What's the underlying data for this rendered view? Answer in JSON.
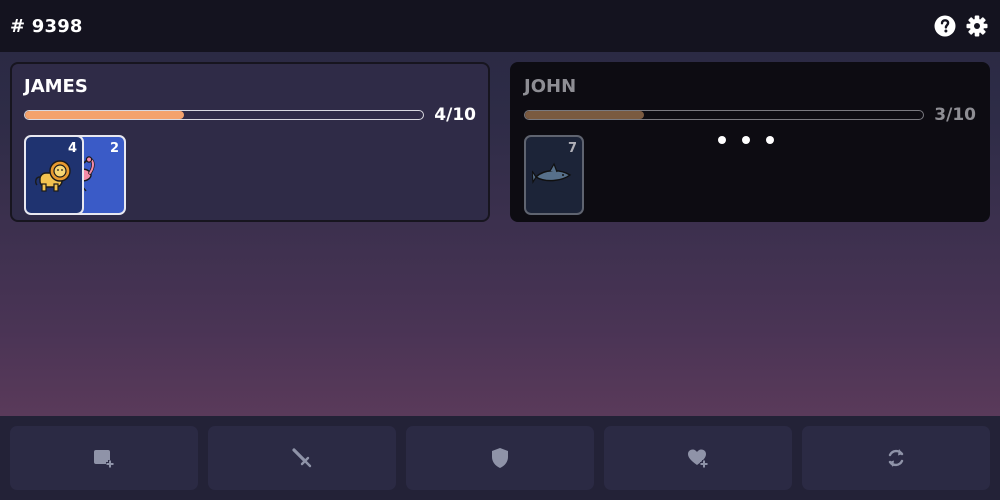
{
  "header": {
    "room_id": "# 9398",
    "icons": [
      "help-icon",
      "gear-icon"
    ]
  },
  "player": {
    "name": "JAMES",
    "progress": 0.4,
    "score": "4/10",
    "accent": "#f4a26c",
    "cards": [
      {
        "value": "4",
        "animal": "lion",
        "color": "#1f3370"
      },
      {
        "value": "2",
        "animal": "flamingo",
        "color": "#3a5bc7"
      }
    ]
  },
  "opponent": {
    "name": "JOHN",
    "progress": 0.3,
    "score": "3/10",
    "status": "thinking",
    "cards": [
      {
        "value": "7",
        "animal": "shark",
        "color": "#1c2438"
      }
    ]
  },
  "actions": [
    {
      "name": "add-card",
      "icon": "add-card-icon"
    },
    {
      "name": "attack",
      "icon": "sword-icon"
    },
    {
      "name": "defend",
      "icon": "shield-icon"
    },
    {
      "name": "heal",
      "icon": "heart-plus-icon"
    },
    {
      "name": "swap",
      "icon": "refresh-icon"
    }
  ]
}
